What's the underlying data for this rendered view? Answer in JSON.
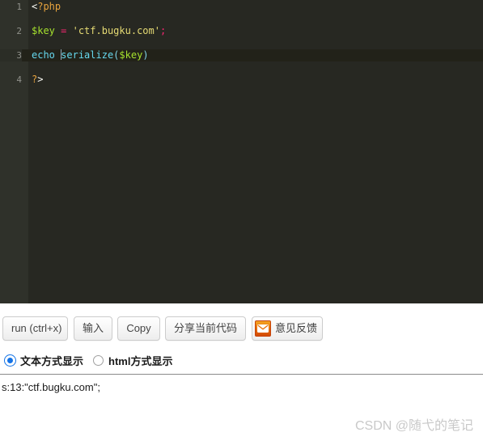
{
  "editor": {
    "language": "php",
    "theme_background": "#272822",
    "gutter_background": "#2f312a",
    "active_line_background": "#222219",
    "line_number_color": "#8f908a",
    "active_line": 3,
    "lines": [
      {
        "number": "1",
        "text": "<?php"
      },
      {
        "number": "2",
        "text": "$key = 'ctf.bugku.com';"
      },
      {
        "number": "3",
        "text": "echo serialize($key)"
      },
      {
        "number": "4",
        "text": "?>"
      }
    ],
    "tokens": {
      "l1_open_lt": "<",
      "l1_open_php": "?php",
      "l2_var": "$key",
      "l2_space1": " ",
      "l2_eq": "=",
      "l2_space2": " ",
      "l2_string": "'ctf.bugku.com'",
      "l2_semi": ";",
      "l3_kw": "echo",
      "l3_space": " ",
      "l3_func": "serialize",
      "l3_paren_open": "(",
      "l3_arg": "$key",
      "l3_paren_close": ")",
      "l4_q": "?",
      "l4_gt": ">"
    },
    "colors": {
      "plain": "#f8f8f2",
      "tag": "#e8a33d",
      "variable": "#a6e22e",
      "operator": "#f92672",
      "string": "#e6db74",
      "keyword": "#66d9ef",
      "punctuation": "#7fd4e8"
    }
  },
  "toolbar": {
    "run_label": "run (ctrl+x)",
    "input_label": "输入",
    "copy_label": "Copy",
    "share_label": "分享当前代码",
    "feedback_label": "意见反馈",
    "feedback_icon": "envelope-icon",
    "feedback_icon_color": "#e8710a"
  },
  "display_mode": {
    "options": [
      {
        "label": "文本方式显示",
        "selected": true
      },
      {
        "label": "html方式显示",
        "selected": false
      }
    ],
    "selected_color": "#1473e6"
  },
  "output": {
    "text": "s:13:\"ctf.bugku.com\";"
  },
  "watermark": {
    "text": "CSDN @随弋的笔记"
  }
}
